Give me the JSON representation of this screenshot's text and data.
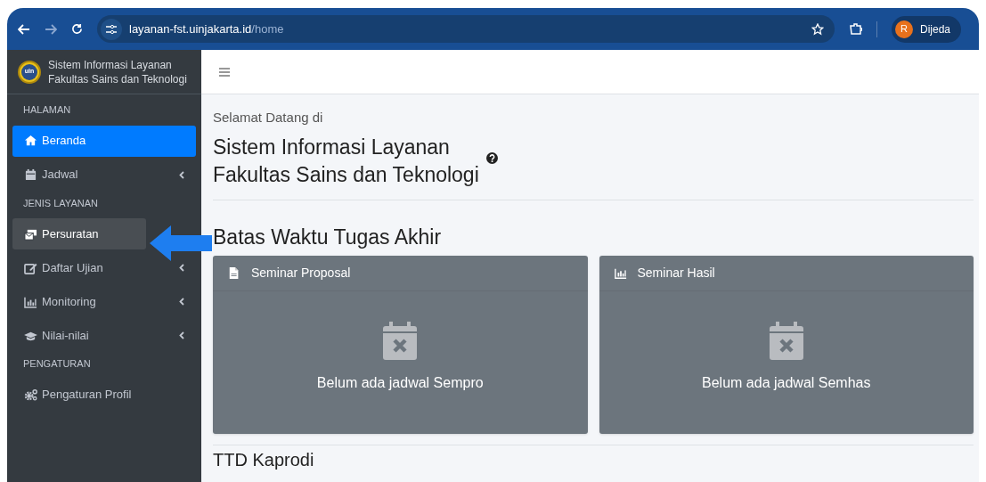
{
  "browser": {
    "url_host": "layanan-fst.uinjakarta.id",
    "url_path": "/home",
    "profile_initial": "R",
    "profile_name": "Dijeda"
  },
  "sidebar": {
    "brand_line_1": "Sistem Informasi Layanan",
    "brand_line_2": "Fakultas Sains dan Teknologi",
    "logo_text": "uin",
    "sections": [
      {
        "header": "HALAMAN",
        "items": [
          {
            "label": "Beranda",
            "selected": true,
            "hovered": false,
            "expandable": false
          },
          {
            "label": "Jadwal",
            "selected": false,
            "hovered": false,
            "expandable": true
          }
        ]
      },
      {
        "header": "JENIS LAYANAN",
        "items": [
          {
            "label": "Persuratan",
            "selected": false,
            "hovered": true,
            "expandable": false
          },
          {
            "label": "Daftar Ujian",
            "selected": false,
            "hovered": false,
            "expandable": true
          },
          {
            "label": "Monitoring",
            "selected": false,
            "hovered": false,
            "expandable": true
          },
          {
            "label": "Nilai-nilai",
            "selected": false,
            "hovered": false,
            "expandable": true
          }
        ]
      },
      {
        "header": "PENGATURAN",
        "items": [
          {
            "label": "Pengaturan Profil",
            "selected": false,
            "hovered": false,
            "expandable": false
          }
        ]
      }
    ]
  },
  "main": {
    "welcome": "Selamat Datang di",
    "title_line_1": "Sistem Informasi Layanan",
    "title_line_2": "Fakultas Sains dan Teknologi",
    "section_title": "Batas Waktu Tugas Akhir",
    "cards": [
      {
        "title": "Seminar Proposal",
        "message": "Belum ada jadwal Sempro"
      },
      {
        "title": "Seminar Hasil",
        "message": "Belum ada jadwal Semhas"
      }
    ],
    "next_section_title": "TTD Kaprodi"
  }
}
